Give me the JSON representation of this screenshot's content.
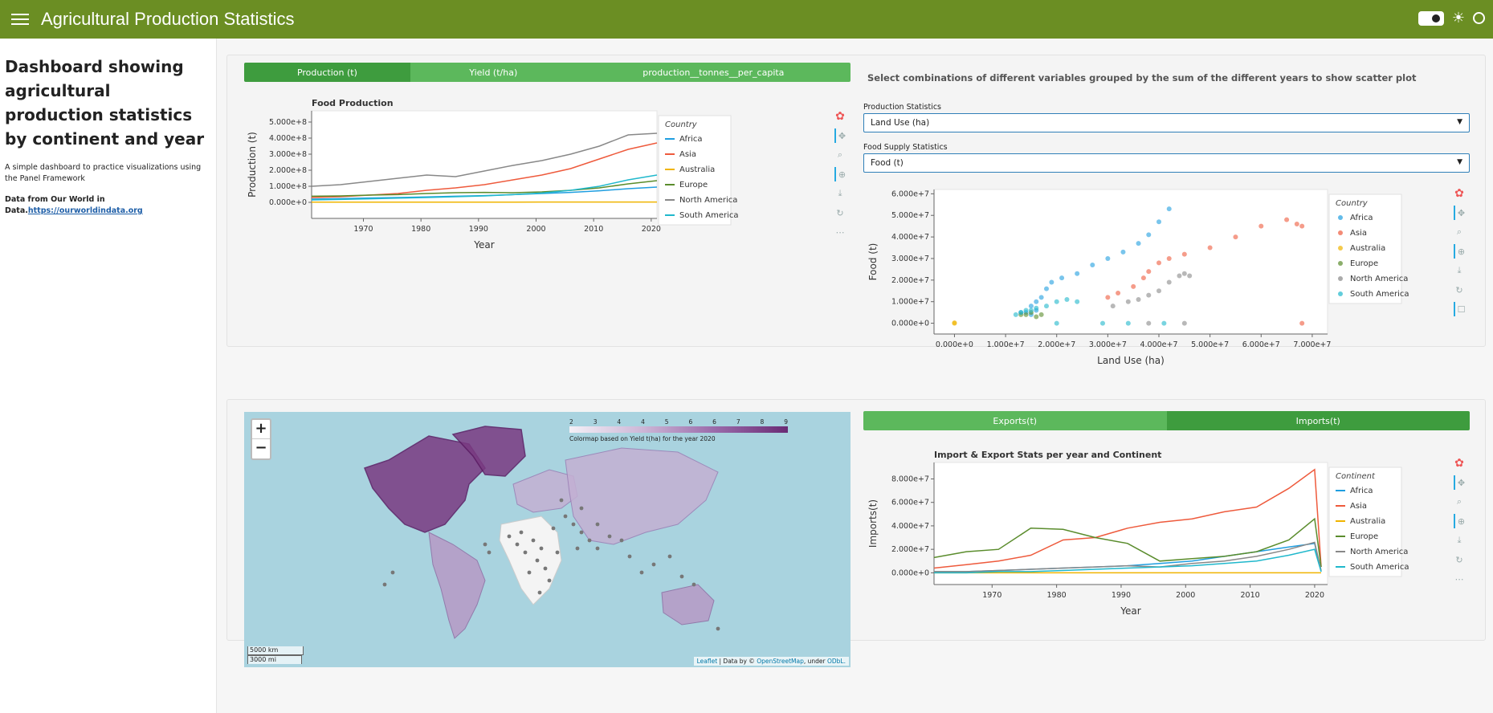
{
  "header": {
    "title": "Agricultural Production Statistics"
  },
  "sidebar": {
    "title": "Dashboard showing agricultural production statistics by continent and year",
    "description": "A simple dashboard to practice visualizations using the Panel Framework",
    "source_prefix": "Data from Our World in Data.",
    "source_link": "https://ourworldindata.org"
  },
  "top_tabs": [
    "Production (t)",
    "Yield (t/ha)",
    "production__tonnes__per_capita"
  ],
  "scatter_description": "Select combinations of different variables grouped by the sum of the different years to show scatter plot",
  "selects": {
    "production_label": "Production Statistics",
    "production_value": "Land Use (ha)",
    "food_label": "Food Supply Statistics",
    "food_value": "Food (t)"
  },
  "bottom_tabs": [
    "Exports(t)",
    "Imports(t)"
  ],
  "map": {
    "zoom_in": "+",
    "zoom_out": "−",
    "scale_km": "5000 km",
    "scale_mi": "3000 mi",
    "attribution_leaflet": "Leaflet",
    "attribution_mid": " | Data by © ",
    "attribution_osm": "OpenStreetMap",
    "attribution_end": ", under ",
    "attribution_odbl": "ODbL.",
    "colormap_ticks": [
      "2",
      "3",
      "4",
      "4",
      "5",
      "6",
      "6",
      "7",
      "8",
      "9"
    ],
    "colormap_label": "Colormap based on Yield t(ha) for the year 2020"
  },
  "colors": {
    "Africa": "#1f9ee0",
    "Asia": "#ee5a3c",
    "Australia": "#f0b400",
    "Europe": "#5a8c2c",
    "North America": "#888888",
    "South America": "#20b8cc"
  },
  "chart_data": [
    {
      "type": "line",
      "title": "Food Production",
      "xlabel": "Year",
      "ylabel": "Production (t)",
      "legend_title": "Country",
      "xlim": [
        1961,
        2021
      ],
      "ylim": [
        -100000000,
        570000000
      ],
      "yticks": [
        "0.000e+0",
        "1.000e+8",
        "2.000e+8",
        "3.000e+8",
        "4.000e+8",
        "5.000e+8"
      ],
      "xticks": [
        "1970",
        "1980",
        "1990",
        "2000",
        "2010",
        "2020"
      ],
      "x": [
        1961,
        1966,
        1971,
        1976,
        1981,
        1986,
        1991,
        1996,
        2001,
        2006,
        2011,
        2016,
        2021
      ],
      "series": [
        {
          "name": "Africa",
          "values": [
            20,
            23,
            27,
            30,
            34,
            38,
            42,
            48,
            55,
            62,
            72,
            85,
            95
          ]
        },
        {
          "name": "Asia",
          "values": [
            30,
            35,
            45,
            55,
            75,
            90,
            110,
            140,
            170,
            210,
            270,
            330,
            370
          ]
        },
        {
          "name": "Australia",
          "values": [
            1,
            1,
            1,
            1,
            1,
            1,
            1,
            1,
            2,
            2,
            2,
            2,
            2
          ]
        },
        {
          "name": "Europe",
          "values": [
            38,
            40,
            45,
            48,
            55,
            60,
            62,
            60,
            65,
            75,
            90,
            115,
            135
          ]
        },
        {
          "name": "North America",
          "values": [
            100,
            110,
            130,
            150,
            170,
            160,
            195,
            230,
            260,
            300,
            350,
            420,
            430
          ]
        },
        {
          "name": "South America",
          "values": [
            15,
            18,
            22,
            26,
            30,
            35,
            40,
            48,
            58,
            75,
            100,
            140,
            170
          ]
        }
      ],
      "value_scale": 1000000
    },
    {
      "type": "scatter",
      "xlabel": "Land Use (ha)",
      "ylabel": "Food (t)",
      "legend_title": "Country",
      "xlim": [
        -4000000,
        73000000
      ],
      "ylim": [
        -5000000,
        62000000
      ],
      "xticks": [
        "0.000e+0",
        "1.000e+7",
        "2.000e+7",
        "3.000e+7",
        "4.000e+7",
        "5.000e+7",
        "6.000e+7",
        "7.000e+7"
      ],
      "yticks": [
        "0.000e+0",
        "1.000e+7",
        "2.000e+7",
        "3.000e+7",
        "4.000e+7",
        "5.000e+7",
        "6.000e+7"
      ],
      "series": [
        {
          "name": "Africa",
          "points": [
            [
              14,
              5
            ],
            [
              15,
              8
            ],
            [
              16,
              10
            ],
            [
              17,
              12
            ],
            [
              18,
              16
            ],
            [
              19,
              19
            ],
            [
              21,
              21
            ],
            [
              24,
              23
            ],
            [
              27,
              27
            ],
            [
              30,
              30
            ],
            [
              33,
              33
            ],
            [
              36,
              37
            ],
            [
              38,
              41
            ],
            [
              40,
              47
            ],
            [
              42,
              53
            ],
            [
              16,
              6
            ],
            [
              15,
              4
            ],
            [
              13,
              5
            ]
          ]
        },
        {
          "name": "Asia",
          "points": [
            [
              30,
              12
            ],
            [
              32,
              14
            ],
            [
              35,
              17
            ],
            [
              37,
              21
            ],
            [
              38,
              24
            ],
            [
              40,
              28
            ],
            [
              42,
              30
            ],
            [
              45,
              32
            ],
            [
              50,
              35
            ],
            [
              55,
              40
            ],
            [
              60,
              45
            ],
            [
              65,
              48
            ],
            [
              67,
              46
            ],
            [
              68,
              45
            ],
            [
              68,
              0
            ]
          ]
        },
        {
          "name": "Australia",
          "points": [
            [
              0,
              0
            ],
            [
              0,
              0.2
            ]
          ]
        },
        {
          "name": "Europe",
          "points": [
            [
              13,
              4
            ],
            [
              14,
              4
            ],
            [
              15,
              5
            ],
            [
              17,
              4
            ],
            [
              16,
              3
            ]
          ]
        },
        {
          "name": "North America",
          "points": [
            [
              31,
              8
            ],
            [
              34,
              10
            ],
            [
              36,
              11
            ],
            [
              38,
              13
            ],
            [
              40,
              15
            ],
            [
              42,
              19
            ],
            [
              44,
              22
            ],
            [
              45,
              23
            ],
            [
              46,
              22
            ],
            [
              38,
              0
            ],
            [
              45,
              0
            ]
          ]
        },
        {
          "name": "South America",
          "points": [
            [
              12,
              4
            ],
            [
              13,
              5
            ],
            [
              14,
              6
            ],
            [
              15,
              6
            ],
            [
              16,
              7
            ],
            [
              18,
              8
            ],
            [
              20,
              10
            ],
            [
              22,
              11
            ],
            [
              24,
              10
            ],
            [
              20,
              0
            ],
            [
              29,
              0
            ],
            [
              34,
              0
            ],
            [
              41,
              0
            ]
          ]
        }
      ],
      "value_scale": 1000000
    },
    {
      "type": "line",
      "title": "Import & Export Stats per year and Continent",
      "xlabel": "Year",
      "ylabel": "Imports(t)",
      "legend_title": "Continent",
      "xlim": [
        1961,
        2022
      ],
      "ylim": [
        -10000000,
        94000000
      ],
      "xticks": [
        "1970",
        "1980",
        "1990",
        "2000",
        "2010",
        "2020"
      ],
      "yticks": [
        "0.000e+0",
        "2.000e+7",
        "4.000e+7",
        "6.000e+7",
        "8.000e+7"
      ],
      "x": [
        1961,
        1966,
        1971,
        1976,
        1981,
        1986,
        1991,
        1996,
        2001,
        2006,
        2011,
        2016,
        2020,
        2021
      ],
      "series": [
        {
          "name": "Africa",
          "values": [
            1,
            1,
            2,
            3,
            4,
            5,
            6,
            8,
            10,
            14,
            18,
            22,
            25,
            1
          ]
        },
        {
          "name": "Asia",
          "values": [
            4,
            7,
            10,
            15,
            28,
            30,
            38,
            43,
            46,
            52,
            56,
            72,
            88,
            5
          ]
        },
        {
          "name": "Australia",
          "values": [
            0,
            0,
            0,
            0,
            0,
            0,
            0,
            0,
            0,
            0,
            0,
            0,
            0,
            0
          ]
        },
        {
          "name": "Europe",
          "values": [
            13,
            18,
            20,
            38,
            37,
            30,
            25,
            10,
            12,
            14,
            18,
            28,
            46,
            5
          ]
        },
        {
          "name": "North America",
          "values": [
            1,
            1,
            2,
            3,
            4,
            5,
            6,
            5,
            8,
            10,
            14,
            20,
            26,
            2
          ]
        },
        {
          "name": "South America",
          "values": [
            0,
            0,
            1,
            1,
            2,
            3,
            4,
            5,
            6,
            8,
            10,
            15,
            20,
            1
          ]
        }
      ],
      "value_scale": 1000000
    }
  ]
}
